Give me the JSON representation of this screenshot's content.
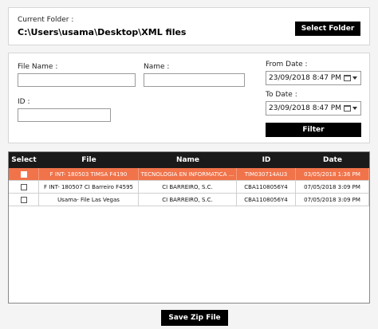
{
  "folder": {
    "label": "Current Folder :",
    "path": "C:\\Users\\usama\\Desktop\\XML files",
    "select_button": "Select Folder"
  },
  "filter": {
    "file_name_label": "File Name :",
    "file_name_value": "",
    "name_label": "Name :",
    "name_value": "",
    "id_label": "ID :",
    "id_value": "",
    "from_date_label": "From Date :",
    "from_date_value": "23/09/2018   8:47 PM",
    "to_date_label": "To Date :",
    "to_date_value": "23/09/2018   8:47 PM",
    "filter_button": "Filter"
  },
  "grid": {
    "columns": [
      "Select",
      "File",
      "Name",
      "ID",
      "Date"
    ],
    "rows": [
      {
        "file": "F INT- 180503 TIMSA F4190",
        "name": "TECNOLOGIA EN INFORMATICA ...",
        "id": "TIM030714AU3",
        "date": "03/05/2018 1:36 PM",
        "selected": true
      },
      {
        "file": "F INT- 180507 CI Barreiro F4595",
        "name": "CI BARREIRO, S.C.",
        "id": "CBA1108056Y4",
        "date": "07/05/2018 3:09 PM",
        "selected": false
      },
      {
        "file": "Usama- File Las Vegas",
        "name": "CI BARREIRO, S.C.",
        "id": "CBA1108056Y4",
        "date": "07/05/2018 3:09 PM",
        "selected": false
      }
    ]
  },
  "actions": {
    "save_zip_button": "Save Zip File"
  },
  "colors": {
    "selected_row": "#f0734a",
    "header_bg": "#1a1a1a",
    "button_bg": "#000000"
  }
}
